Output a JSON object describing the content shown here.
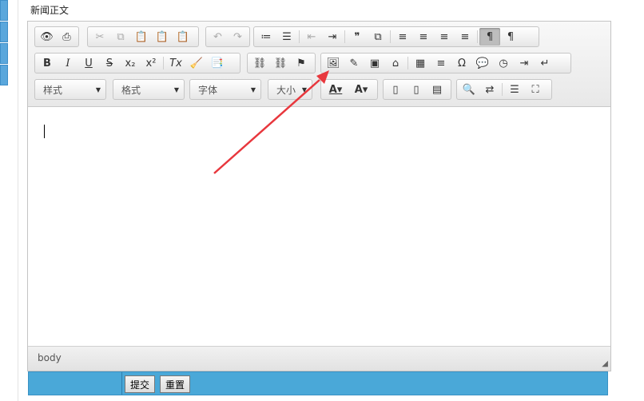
{
  "form": {
    "field_label": "新闻正文",
    "submit_label": "提交",
    "reset_label": "重置"
  },
  "toolbar": {
    "row1": [
      [
        "👁",
        "⎙"
      ],
      [
        "✂",
        "⧉",
        "📋",
        "📋",
        "📋"
      ],
      [
        "↶",
        "↷"
      ],
      [
        "≔",
        "☰",
        "⇤",
        "⇥",
        "❞",
        "⧉",
        "≡",
        "≡",
        "≡",
        "≡",
        "¶",
        "¶"
      ]
    ],
    "row2": [
      [
        "B",
        "I",
        "U",
        "S",
        "x₂",
        "x²",
        "Tx",
        "🧹",
        "📑"
      ],
      [
        "⛓",
        "⛓",
        "⚑"
      ],
      [
        "🖼",
        "✎",
        "▣",
        "⌂",
        "▦",
        "≡",
        "Ω",
        "💬",
        "◷",
        "⇥",
        "↵"
      ],
      [
        "A",
        "A"
      ],
      [
        "▯",
        "▯",
        "▤"
      ],
      [
        "🔍",
        "⇄",
        "☰",
        "⛶"
      ]
    ],
    "combos": {
      "styles": "样式",
      "format": "格式",
      "font": "字体",
      "size": "大小"
    }
  },
  "status": {
    "path": "body"
  },
  "accent_color": "#4aa8d8",
  "annotation_color": "#e8373d"
}
